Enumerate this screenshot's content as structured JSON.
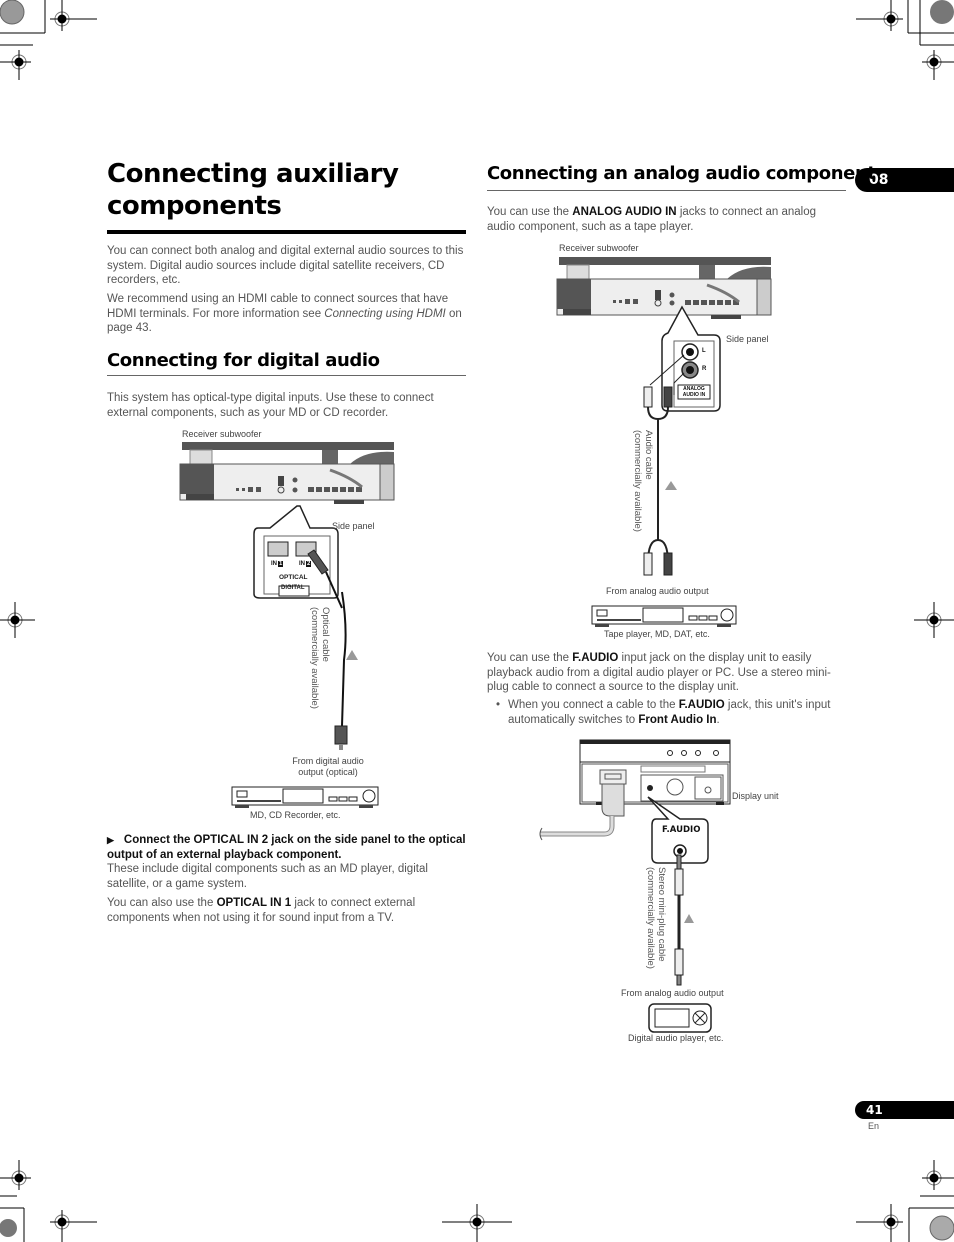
{
  "chapter_number": "08",
  "page": {
    "number": "41",
    "language": "En"
  },
  "left_column": {
    "title": "Connecting auxiliary components",
    "intro_paragraphs": [
      "You can connect both analog and digital external audio sources to this system. Digital audio sources include digital satellite receivers, CD recorders, etc.",
      {
        "before": "We recommend using an HDMI cable to connect sources that have HDMI terminals. For more information see ",
        "link": "Connecting using HDMI",
        "after": " on page 43."
      }
    ],
    "digital_section": {
      "heading": "Connecting for digital audio",
      "intro": "This system has optical-type digital inputs. Use these to connect external components, such as your MD or CD recorder.",
      "figure": {
        "receiver_label": "Receiver subwoofer",
        "side_panel_label": "Side panel",
        "jack_labels": [
          "IN",
          "1",
          "IN",
          "2"
        ],
        "optical_label": "OPTICAL",
        "digital_label": "DIGITAL",
        "cable_label_line1": "Optical cable",
        "cable_label_line2": "(commercially available)",
        "source_label_line1": "From digital audio",
        "source_label_line2": "output (optical)",
        "device_label": "MD, CD Recorder, etc."
      },
      "step_marker": "▶",
      "step": "Connect the OPTICAL IN 2 jack on the side panel to the optical output of an external playback component.",
      "step_detail": "These include digital components such as an MD player, digital satellite, or a game system.",
      "note": {
        "before": "You can also use the ",
        "bold": "OPTICAL IN 1",
        "after": " jack to connect external components when not using it for sound input from a TV."
      }
    }
  },
  "right_column": {
    "analog_section": {
      "heading": "Connecting an analog audio component",
      "intro": {
        "before": "You can use the ",
        "bold": "ANALOG AUDIO IN",
        "after": " jacks to connect an analog audio component, such as a tape player."
      },
      "figure": {
        "receiver_label": "Receiver subwoofer",
        "side_panel_label": "Side panel",
        "jack_l": "L",
        "jack_r": "R",
        "panel_label_line1": "ANALOG",
        "panel_label_line2": "AUDIO IN",
        "cable_label_line1": "Audio cable",
        "cable_label_line2": "(commercially available)",
        "source_label": "From analog audio output",
        "device_label": "Tape player, MD, DAT, etc."
      }
    },
    "faudio": {
      "intro": {
        "before": "You can use the ",
        "bold": "F.AUDIO",
        "after": " input jack on the display unit to easily playback audio from a digital audio player or PC. Use a stereo mini-plug cable to connect a source to the display unit."
      },
      "bullet": {
        "marker": "•",
        "before": "When you connect a cable to the ",
        "bold1": "F.AUDIO",
        "middle": " jack, this unit's input automatically switches to ",
        "bold2": "Front Audio In",
        "after": "."
      },
      "figure": {
        "display_unit_label": "Display unit",
        "jack_label": "F.AUDIO",
        "cable_label_line1": "Stereo mini-plug cable",
        "cable_label_line2": "(commercially available)",
        "source_label": "From analog audio output",
        "device_label": "Digital audio player, etc."
      }
    }
  }
}
